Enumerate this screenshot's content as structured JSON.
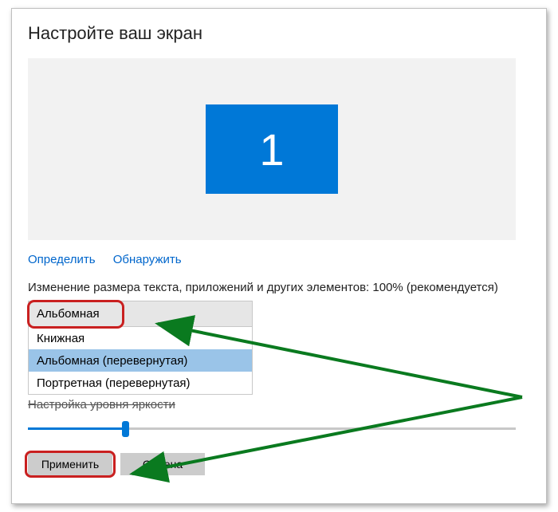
{
  "title": "Настройте ваш экран",
  "monitor": {
    "number": "1"
  },
  "links": {
    "identify": "Определить",
    "detect": "Обнаружить"
  },
  "scale_label": "Изменение размера текста, приложений и других элементов: 100% (рекомендуется)",
  "orientation": {
    "current": "Альбомная",
    "options": [
      "Книжная",
      "Альбомная (перевернутая)",
      "Портретная (перевернутая)"
    ],
    "highlighted_index": 1
  },
  "brightness_label": "Настройка уровня яркости",
  "slider": {
    "percent": 20
  },
  "buttons": {
    "apply": "Применить",
    "cancel": "Отмена"
  }
}
